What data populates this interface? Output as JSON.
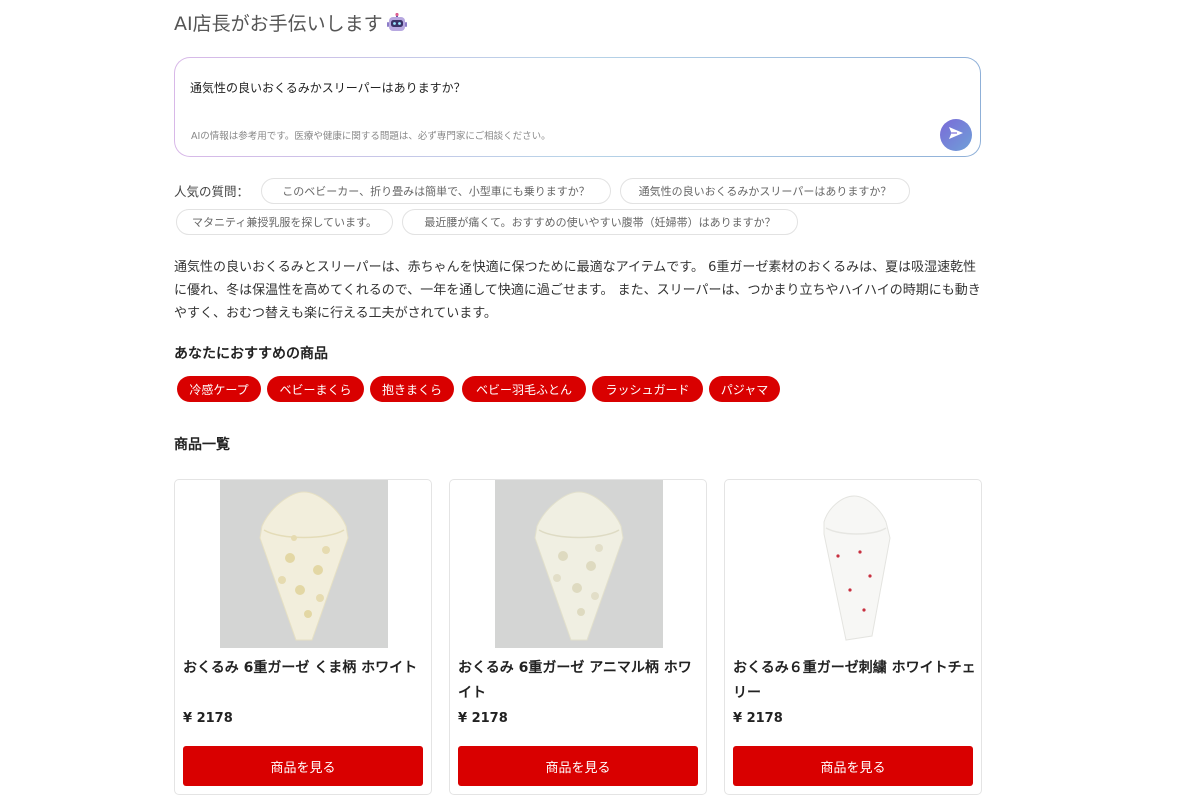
{
  "header": {
    "title": "AI店長がお手伝いします",
    "robot_icon": "robot-icon"
  },
  "chat": {
    "input_value": "通気性の良いおくるみかスリーパーはありますか？",
    "disclaimer": "AIの情報は参考用です。医療や健康に関する問題は、必ず専門家にご相談ください。",
    "send_icon": "send-icon",
    "accent_colors": [
      "#7a6ad8",
      "#6fa0d8"
    ]
  },
  "popular": {
    "label": "人気の質問：",
    "chips": [
      "このベビーカー、折り畳みは簡単で、小型車にも乗りますか？",
      "通気性の良いおくるみかスリーパーはありますか？",
      "マタニティ兼授乳服を探しています。",
      "最近腰が痛くて。おすすめの使いやすい腹帯（妊婦帯）はありますか？"
    ]
  },
  "answer": {
    "text": "通気性の良いおくるみとスリーパーは、赤ちゃんを快適に保つために最適なアイテムです。 6重ガーゼ素材のおくるみは、夏は吸湿速乾性に優れ、冬は保温性を高めてくれるので、一年を通して快適に過ごせます。 また、スリーパーは、つかまり立ちやハイハイの時期にも動きやすく、おむつ替えも楽に行える工夫がされています。"
  },
  "recommend": {
    "title": "あなたにおすすめの商品",
    "tags": [
      "冷感ケープ",
      "ベビーまくら",
      "抱きまくら",
      "ベビー羽毛ふとん",
      "ラッシュガード",
      "パジャマ"
    ],
    "tag_color": "#d90000"
  },
  "products": {
    "title": "商品一覧",
    "items": [
      {
        "name": "おくるみ 6重ガーゼ くま柄 ホワイト",
        "price": "¥ 2178",
        "button": "商品を見る"
      },
      {
        "name": "おくるみ 6重ガーゼ アニマル柄 ホワイト",
        "price": "¥ 2178",
        "button": "商品を見る"
      },
      {
        "name": "おくるみ６重ガーゼ刺繍 ホワイトチェリー",
        "price": "¥ 2178",
        "button": "商品を見る"
      }
    ]
  }
}
